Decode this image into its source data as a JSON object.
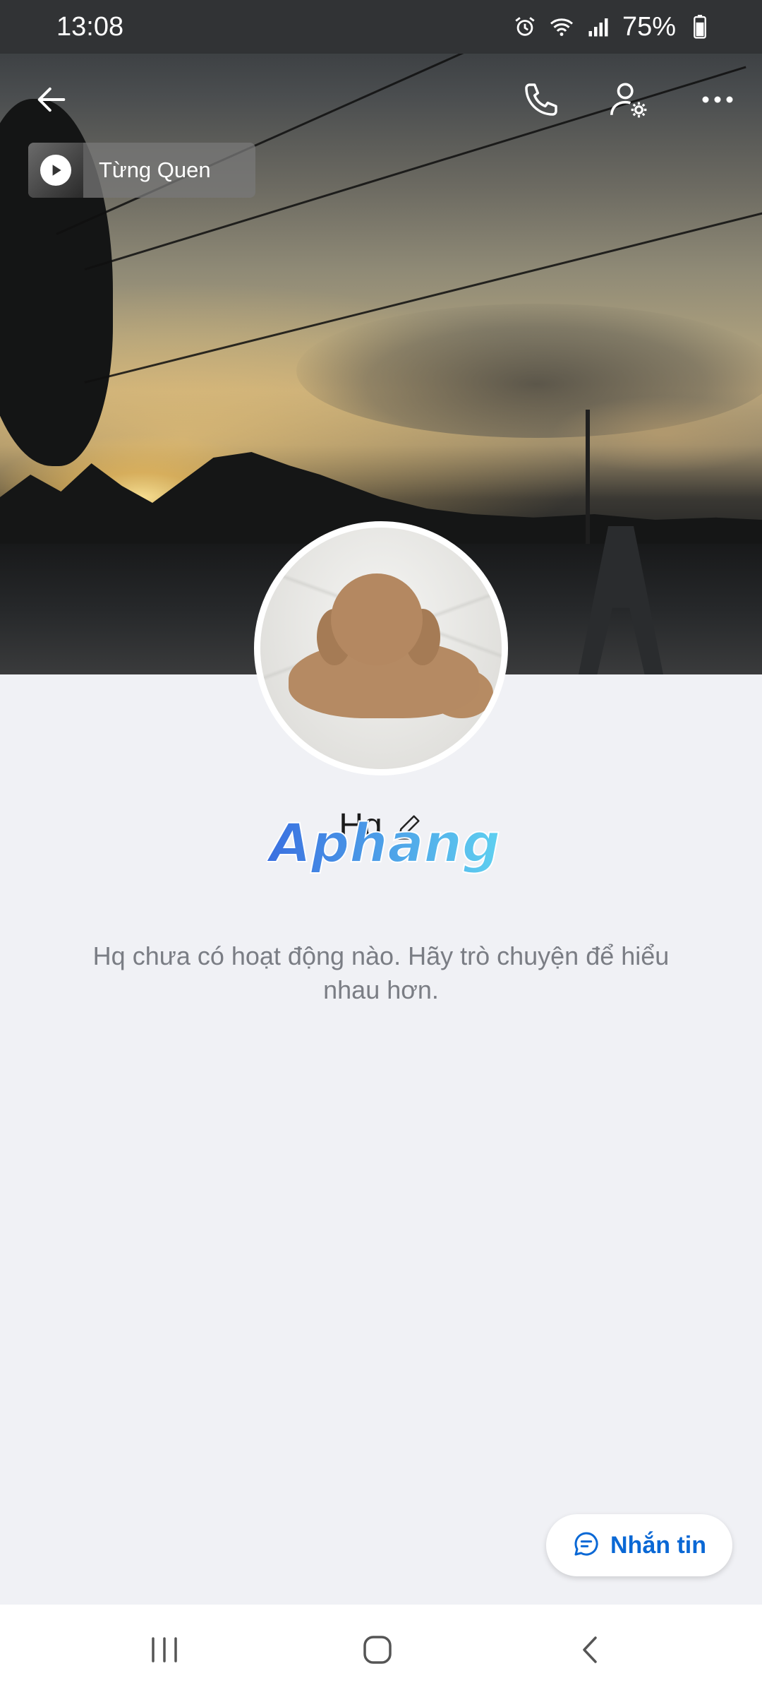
{
  "status_bar": {
    "time": "13:08",
    "battery": "75%",
    "icons": [
      "alarm-icon",
      "wifi-icon",
      "signal-icon",
      "battery-icon"
    ]
  },
  "top_bar": {
    "icons": [
      "back-arrow-icon",
      "phone-icon",
      "user-settings-icon",
      "more-icon"
    ]
  },
  "music": {
    "title": "Từng Quen",
    "icon": "play-icon"
  },
  "profile": {
    "name": "Hq",
    "edit_icon": "pencil-icon",
    "empty_message": "Hq chưa có hoạt động nào. Hãy trò chuyện để hiểu nhau hơn."
  },
  "watermark": {
    "text": "Aphang"
  },
  "actions": {
    "message_label": "Nhắn tin",
    "message_icon": "chat-bubble-icon"
  },
  "nav": {
    "icons": [
      "recents-icon",
      "home-icon",
      "back-icon"
    ]
  },
  "colors": {
    "accent": "#0a68d5",
    "background": "#f0f1f5",
    "status_bar": "#313335"
  }
}
